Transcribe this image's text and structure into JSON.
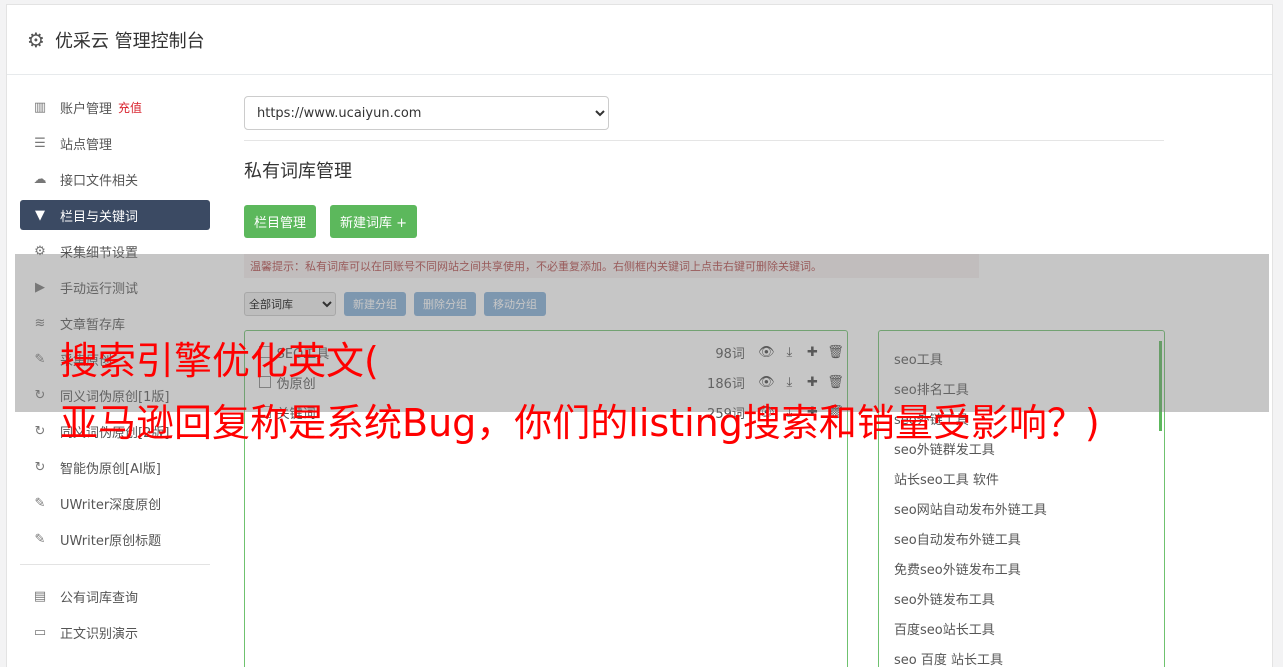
{
  "header": {
    "title": "优采云 管理控制台",
    "icon": "gear-icon"
  },
  "sidebar": {
    "items": [
      {
        "label": "账户管理",
        "badge": "充值",
        "icon": "bar-chart-icon",
        "active": false
      },
      {
        "label": "站点管理",
        "icon": "server-icon",
        "active": false
      },
      {
        "label": "接口文件相关",
        "icon": "cloud-upload-icon",
        "active": false
      },
      {
        "label": "栏目与关键词",
        "icon": "filter-icon",
        "active": true
      },
      {
        "label": "采集细节设置",
        "icon": "cogs-icon",
        "active": false
      },
      {
        "label": "手动运行测试",
        "icon": "play-icon",
        "active": false
      },
      {
        "label": "文章暂存库",
        "icon": "database-icon",
        "active": false
      },
      {
        "label": "采集原创",
        "icon": "edit-icon",
        "active": false
      },
      {
        "label": "同义词伪原创[1版]",
        "icon": "refresh-icon",
        "active": false
      },
      {
        "label": "同义词伪原创[2版]",
        "icon": "refresh-icon",
        "active": false
      },
      {
        "label": "智能伪原创[AI版]",
        "icon": "refresh-icon",
        "active": false
      },
      {
        "label": "UWriter深度原创",
        "icon": "edit-icon",
        "active": false
      },
      {
        "label": "UWriter原创标题",
        "icon": "edit-icon",
        "active": false
      }
    ],
    "items2": [
      {
        "label": "公有词库查询",
        "icon": "book-icon"
      },
      {
        "label": "正文识别演示",
        "icon": "monitor-icon"
      }
    ]
  },
  "main": {
    "site_select": "https://www.ucaiyun.com",
    "section_title": "私有词库管理",
    "btn_column": "栏目管理",
    "btn_new_lib": "新建词库 +",
    "tip": "温馨提示：私有词库可以在同账号不同网站之间共享使用，不必重复添加。右侧框内关键词上点击右键可删除关键词。",
    "group_select": "全部词库",
    "btn_new_group": "新建分组",
    "btn_del_group": "删除分组",
    "btn_move_group": "移动分组",
    "libraries": [
      {
        "name": "SEO工具",
        "count": "98词"
      },
      {
        "name": "伪原创",
        "count": "186词"
      },
      {
        "name": "关键词",
        "count": "259词"
      }
    ],
    "keywords": [
      "seo工具",
      "seo排名工具",
      "seo外链工具",
      "seo外链群发工具",
      "站长seo工具 软件",
      "seo网站自动发布外链工具",
      "seo自动发布外链工具",
      "免费seo外链发布工具",
      "seo外链发布工具",
      "百度seo站长工具",
      "seo 百度 站长工具"
    ]
  },
  "overlay": {
    "line1": "搜索引擎优化英文(",
    "line2": "亚马逊回复称是系统Bug，你们的listing搜索和销量受影响？)"
  },
  "colors": {
    "accent_green": "#5cb85c",
    "active_nav": "#3b4a63",
    "overlay_text": "#ff0000"
  }
}
